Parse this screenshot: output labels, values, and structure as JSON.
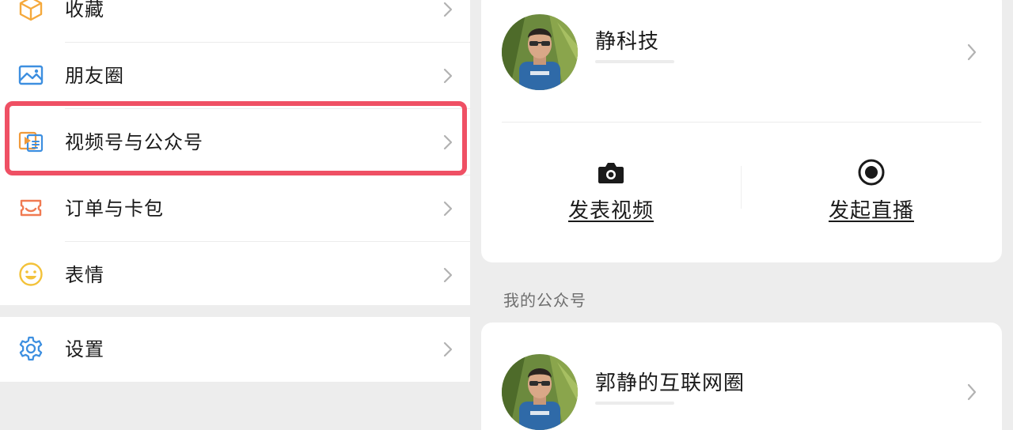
{
  "menu": {
    "group1": [
      {
        "label": "收藏",
        "icon": "favorites-cube-icon"
      },
      {
        "label": "朋友圈",
        "icon": "moments-image-icon"
      },
      {
        "label": "视频号与公众号",
        "icon": "channels-play-icon"
      },
      {
        "label": "订单与卡包",
        "icon": "orders-wallet-icon"
      },
      {
        "label": "表情",
        "icon": "sticker-smile-icon"
      }
    ],
    "group2": [
      {
        "label": "设置",
        "icon": "gear-icon"
      }
    ],
    "highlighted_item": "视频号与公众号",
    "highlight_color": "#ef5064"
  },
  "channel_card": {
    "name": "静科技",
    "actions": [
      {
        "label": "发表视频",
        "icon": "camera-icon"
      },
      {
        "label": "发起直播",
        "icon": "live-record-icon"
      }
    ]
  },
  "official_accounts": {
    "section_label": "我的公众号",
    "items": [
      {
        "name": "郭静的互联网圈"
      }
    ]
  },
  "colors": {
    "background": "#ededed",
    "card": "#ffffff",
    "text": "#1a1a1a",
    "secondary_text": "#6f6f6f",
    "favorites_icon": "#f5a93c",
    "moments_icon": "#3d8fe0",
    "channels_icon": "#f09a3a",
    "orders_icon": "#f07a52",
    "sticker_icon": "#f3c23a",
    "settings_icon": "#3d8fe0"
  }
}
